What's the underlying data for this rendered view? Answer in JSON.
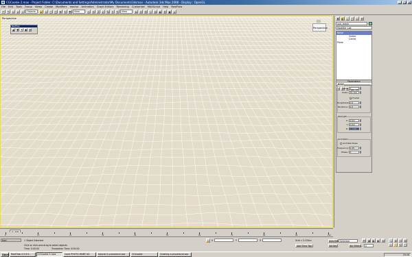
{
  "window": {
    "title": "CGCookie 2.max - Project Folder: C:\\Documents and Settings\\Administrator\\My Documents\\3dsmax - Autodesk 3ds Max 2008 - Display : OpenGL",
    "minimize": "_",
    "maximize": "□",
    "close": "×"
  },
  "menu": [
    "File",
    "Edit",
    "Tools",
    "Group",
    "Views",
    "Create",
    "Modifiers",
    "reactor",
    "Animation",
    "Graph Editors",
    "Rendering",
    "Customize",
    "MAXScript",
    "Help",
    "RealFlow"
  ],
  "toolbar": {
    "selection_filter": "Objects",
    "view_dropdown": "View",
    "view_dropdown2": "View"
  },
  "viewport": {
    "label": "Perspective",
    "nav_label": "Perspective"
  },
  "floater": {
    "title": "RealFlow"
  },
  "command_panel": {
    "object_name": "xxx_mesh",
    "modifier_list": "Modifier List",
    "stack": [
      {
        "label": "Noise",
        "selected": true
      },
      {
        "label": "Gizmo",
        "selected": false,
        "sub": true
      },
      {
        "label": "Center",
        "selected": false,
        "sub": true
      },
      {
        "label": "Plane",
        "selected": false
      }
    ],
    "parameters_title": "Parameters",
    "noise_group": "Noise:",
    "seed_label": "Seed:",
    "seed_value": "0",
    "scale_label": "Scale:",
    "scale_value": "35.702",
    "fractal_label": "Fractal",
    "roughness_label": "Roughness:",
    "roughness_value": "0.0",
    "iterations_label": "Iterations:",
    "iterations_value": "6.0",
    "strength_group": "Strength:",
    "x_label": "X:",
    "x_value": "0.0m",
    "y_label": "Y:",
    "y_value": "0.0m",
    "z_label": "Z:",
    "z_value": "0.028m",
    "animation_group": "Animation:",
    "animate_noise_label": "Animate Noise",
    "frequency_label": "Frequency:",
    "frequency_value": "0.25",
    "phase_label": "Phase:",
    "phase_value": "0"
  },
  "timeline": {
    "slider_label": "0 / 100",
    "ruler_labels": [
      "0",
      "10",
      "20",
      "30",
      "40",
      "50",
      "60",
      "70",
      "80",
      "90",
      "100"
    ]
  },
  "status": {
    "selection_count": "1 Object Selected",
    "prompt": "Click or click-and-drag to select objects",
    "script_label": "Kiwi",
    "time_label": "Time: 0:00:00",
    "translation_label": "Translation Time: 0:00:00",
    "x_label": "X",
    "y_label": "Y",
    "z_label": "Z",
    "grid_label": "Grid = 0.254m",
    "add_time_tag": "Add Time Tag",
    "auto_key": "Auto Key",
    "selected": "Selected",
    "set_key": "Set Key",
    "key_filters": "Key Filters...",
    "frame": "0"
  },
  "taskbar": {
    "start": "Start",
    "tasks": [
      {
        "label": "RealFlow 4 0 6 0...",
        "active": false
      },
      {
        "label": "CGCookie 2.max",
        "active": true
      },
      {
        "label": "Corel PHOTO-PAINT X4",
        "active": false
      },
      {
        "label": "tutorial 2 procedural sea",
        "active": false
      },
      {
        "label": "CGCookie",
        "active": false
      },
      {
        "label": "Creating a procedural sea",
        "active": false
      }
    ],
    "clock": "19:16"
  },
  "colors": {
    "viewport_bg": "#e3dccb",
    "grid": "#ffffff",
    "viewport_border": "#f0e030",
    "title_blue": "#0a246a",
    "stack_selected": "#6a7ecc",
    "object_color": "#6ad0c0"
  }
}
